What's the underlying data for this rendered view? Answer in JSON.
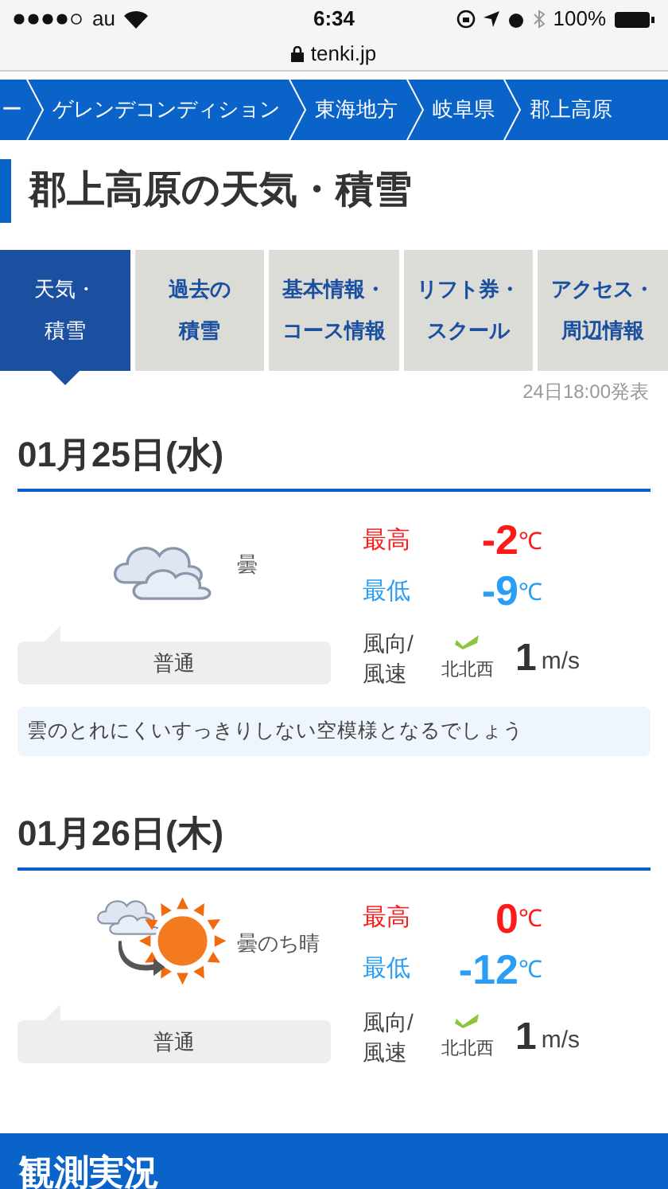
{
  "status_bar": {
    "carrier": "au",
    "time": "6:34",
    "url": "tenki.jp",
    "battery": "100%"
  },
  "breadcrumb": [
    "ー",
    "ゲレンデコンディション",
    "東海地方",
    "岐阜県",
    "郡上高原"
  ],
  "title": "郡上高原の天気・積雪",
  "tabs": [
    {
      "lines": [
        "天気・",
        "積雪"
      ],
      "selected": true
    },
    {
      "lines": [
        "過去の",
        "積雪"
      ],
      "selected": false
    },
    {
      "lines": [
        "基本情報・",
        "コース情報"
      ],
      "selected": false
    },
    {
      "lines": [
        "リフト券・",
        "スクール"
      ],
      "selected": false
    },
    {
      "lines": [
        "アクセス・",
        "周辺情報"
      ],
      "selected": false
    }
  ],
  "issued": "24日18:00発表",
  "days": [
    {
      "date": "01月25日(水)",
      "kind": "cloudy",
      "weather": "曇",
      "snow": "普通",
      "high_label": "最高",
      "high": "-2",
      "high_unit": "℃",
      "low_label": "最低",
      "low": "-9",
      "low_unit": "℃",
      "wind_label": [
        "風向/",
        "風速"
      ],
      "wind_dir": "北北西",
      "wind_speed": "1",
      "wind_unit": "m/s",
      "comment": "雲のとれにくいすっきりしない空模様となるでしょう"
    },
    {
      "date": "01月26日(木)",
      "kind": "cloudy_then_sunny",
      "weather": "曇のち晴",
      "snow": "普通",
      "high_label": "最高",
      "high": "0",
      "high_unit": "℃",
      "low_label": "最低",
      "low": "-12",
      "low_unit": "℃",
      "wind_label": [
        "風向/",
        "風速"
      ],
      "wind_dir": "北北西",
      "wind_speed": "1",
      "wind_unit": "m/s"
    }
  ],
  "section_title": "観測実況"
}
